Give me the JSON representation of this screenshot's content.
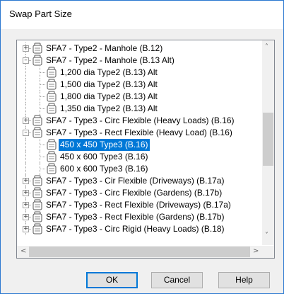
{
  "dialog": {
    "title": "Swap Part Size"
  },
  "tree": {
    "items": [
      {
        "label": "SFA7 - Type2 - Manhole (B.12)",
        "level": 0,
        "expander": "+",
        "selected": false
      },
      {
        "label": "SFA7 - Type2 - Manhole (B.13 Alt)",
        "level": 0,
        "expander": "-",
        "selected": false
      },
      {
        "label": "1,200 dia Type2 (B.13) Alt",
        "level": 1,
        "expander": "",
        "selected": false
      },
      {
        "label": "1,500 dia Type2 (B.13) Alt",
        "level": 1,
        "expander": "",
        "selected": false
      },
      {
        "label": "1,800 dia Type2 (B.13) Alt",
        "level": 1,
        "expander": "",
        "selected": false
      },
      {
        "label": "1,350 dia Type2 (B.13) Alt",
        "level": 1,
        "expander": "",
        "selected": false
      },
      {
        "label": "SFA7 - Type3 - Circ Flexible (Heavy Loads) (B.16)",
        "level": 0,
        "expander": "+",
        "selected": false
      },
      {
        "label": "SFA7 - Type3 - Rect Flexible (Heavy Load) (B.16)",
        "level": 0,
        "expander": "-",
        "selected": false
      },
      {
        "label": "450 x 450 Type3 (B.16)",
        "level": 1,
        "expander": "",
        "selected": true
      },
      {
        "label": "450 x 600 Type3 (B.16)",
        "level": 1,
        "expander": "",
        "selected": false
      },
      {
        "label": "600 x 600 Type3 (B.16)",
        "level": 1,
        "expander": "",
        "selected": false
      },
      {
        "label": "SFA7 - Type3 - Cir Flexible (Driveways) (B.17a)",
        "level": 0,
        "expander": "+",
        "selected": false
      },
      {
        "label": "SFA7 - Type3 - Circ Flexible (Gardens) (B.17b)",
        "level": 0,
        "expander": "+",
        "selected": false
      },
      {
        "label": "SFA7 - Type3 - Rect Flexible (Driveways) (B.17a)",
        "level": 0,
        "expander": "+",
        "selected": false
      },
      {
        "label": "SFA7 - Type3 - Rect Flexible (Gardens) (B.17b)",
        "level": 0,
        "expander": "+",
        "selected": false
      },
      {
        "label": "SFA7 - Type3 - Circ Rigid (Heavy Loads) (B.18)",
        "level": 0,
        "expander": "+",
        "selected": false
      }
    ]
  },
  "scroll": {
    "up": "˄",
    "down": "˅",
    "left": "<",
    "right": ">"
  },
  "buttons": {
    "ok": "OK",
    "cancel": "Cancel",
    "help": "Help"
  },
  "colors": {
    "selection": "#0078d7",
    "default_button_border": "#0078d7"
  }
}
